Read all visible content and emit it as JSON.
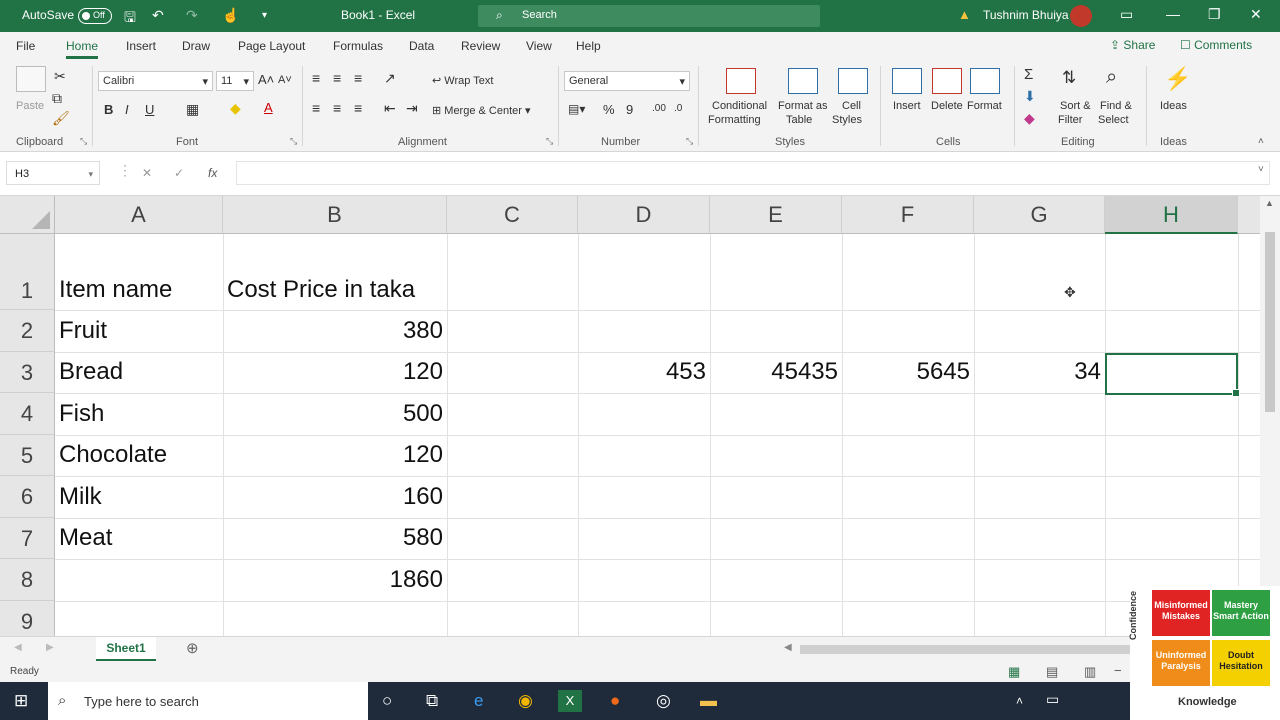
{
  "titlebar": {
    "autosave_label": "AutoSave",
    "autosave_state": "Off",
    "doc_title": "Book1 - Excel",
    "search_placeholder": "Search",
    "user_name": "Tushnim Bhuiya",
    "accent_color": "#217346"
  },
  "menu": {
    "tabs": [
      "File",
      "Home",
      "Insert",
      "Draw",
      "Page Layout",
      "Formulas",
      "Data",
      "Review",
      "View",
      "Help"
    ],
    "active_tab": "Home",
    "share_label": "Share",
    "comments_label": "Comments"
  },
  "ribbon": {
    "clipboard": {
      "paste_label": "Paste",
      "group_label": "Clipboard"
    },
    "font": {
      "family": "Calibri",
      "size": "11",
      "group_label": "Font"
    },
    "alignment": {
      "wrap_text": "Wrap Text",
      "merge_center": "Merge & Center",
      "group_label": "Alignment"
    },
    "number": {
      "format": "General",
      "group_label": "Number"
    },
    "styles": {
      "conditional_1": "Conditional",
      "conditional_2": "Formatting",
      "format_table_1": "Format as",
      "format_table_2": "Table",
      "cell_styles_1": "Cell",
      "cell_styles_2": "Styles",
      "group_label": "Styles"
    },
    "cells": {
      "insert": "Insert",
      "delete": "Delete",
      "format": "Format",
      "group_label": "Cells"
    },
    "editing": {
      "sort_1": "Sort &",
      "sort_2": "Filter",
      "find_1": "Find &",
      "find_2": "Select",
      "group_label": "Editing"
    },
    "ideas": {
      "label": "Ideas",
      "group_label": "Ideas"
    }
  },
  "formula_bar": {
    "name_box": "H3",
    "fx": "fx",
    "formula": ""
  },
  "grid": {
    "columns": [
      "A",
      "B",
      "C",
      "D",
      "E",
      "F",
      "G",
      "H"
    ],
    "selected_column": "H",
    "rows": [
      "1",
      "2",
      "3",
      "4",
      "5",
      "6",
      "7",
      "8",
      "9"
    ],
    "cells": {
      "A1": "Item name",
      "B1": "Cost Price in taka",
      "A2": "Fruit",
      "B2": "380",
      "A3": "Bread",
      "B3": "120",
      "D3": "453",
      "E3": "45435",
      "F3": "5645",
      "G3": "34",
      "A4": "Fish",
      "B4": "500",
      "A5": "Chocolate",
      "B5": "120",
      "A6": "Milk",
      "B6": "160",
      "A7": "Meat",
      "B7": "580",
      "B8": "1860"
    },
    "selected_cell": "H3"
  },
  "sheets": {
    "tabs": [
      "Sheet1"
    ],
    "active": "Sheet1"
  },
  "status": {
    "text": "Ready"
  },
  "taskbar": {
    "search_placeholder": "Type here to search"
  },
  "overlay": {
    "side_label": "Confidence",
    "q1": "Misinformed Mistakes",
    "q2": "Mastery Smart Action",
    "q3": "Uninformed Paralysis",
    "q4": "Doubt Hesitation",
    "bottom_label": "Knowledge",
    "colors": {
      "q1": "#e02424",
      "q2": "#2ea043",
      "q3": "#f08c1a",
      "q4": "#f5d000"
    }
  }
}
